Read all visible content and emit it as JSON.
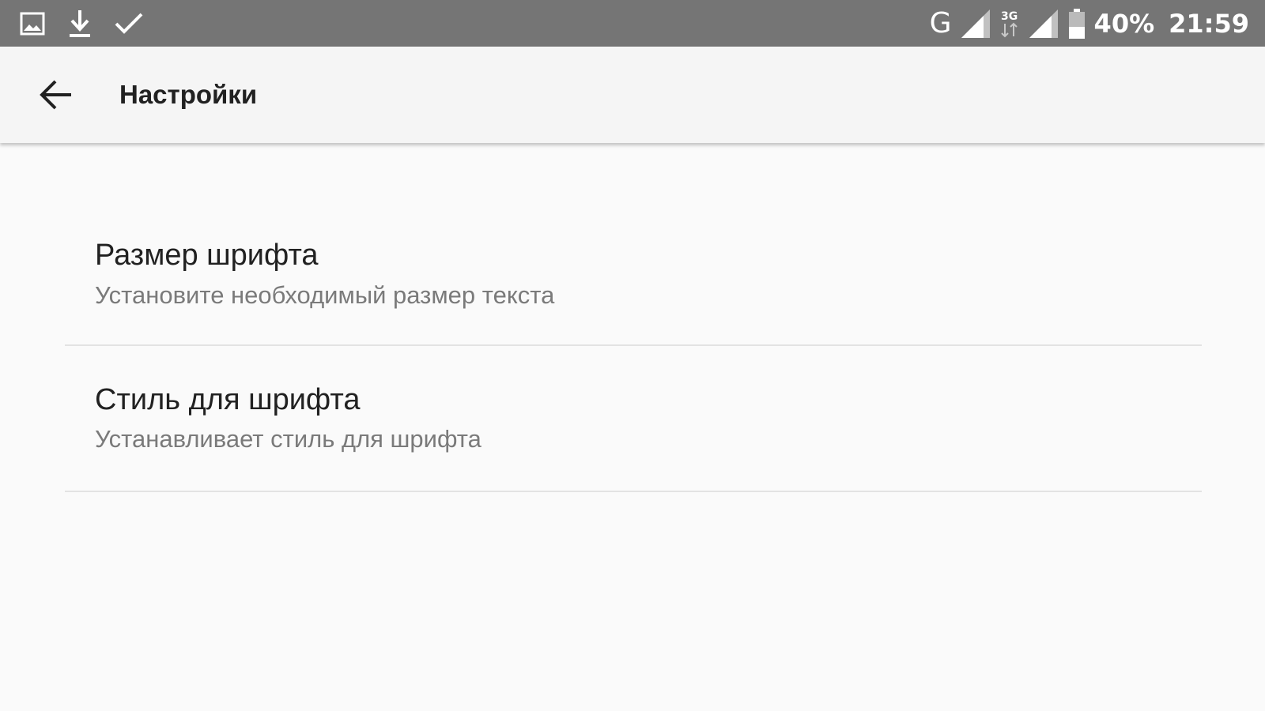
{
  "status_bar": {
    "left_icons": [
      "image-notification-icon",
      "download-icon",
      "check-icon"
    ],
    "network_label": "G",
    "network2_label": "3G",
    "battery": "40%",
    "time": "21:59",
    "background": "#757575"
  },
  "toolbar": {
    "back_icon": "arrow-back-icon",
    "title": "Настройки"
  },
  "preferences": [
    {
      "title": "Размер шрифта",
      "summary": "Установите необходимый размер текста"
    },
    {
      "title": "Стиль для шрифта",
      "summary": "Устанавливает стиль для шрифта"
    }
  ],
  "colors": {
    "background": "#fafafa",
    "toolbar": "#f5f5f5",
    "title_text": "#212121",
    "summary_text": "#7a7a7a",
    "divider": "#e3e3e3"
  }
}
